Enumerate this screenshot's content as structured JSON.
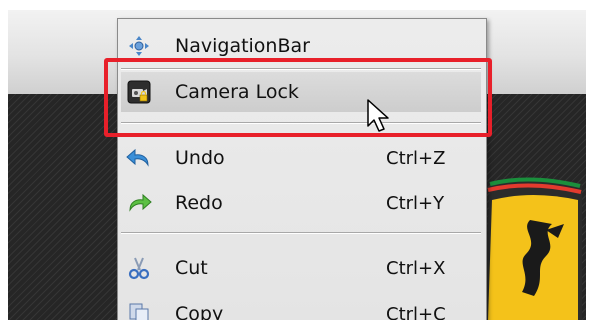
{
  "menu": {
    "items": [
      {
        "label": "NavigationBar",
        "shortcut": "",
        "icon": "navigation-arrows-icon"
      },
      {
        "label": "Camera Lock",
        "shortcut": "",
        "icon": "camera-lock-icon"
      },
      {
        "label": "Undo",
        "shortcut": "Ctrl+Z",
        "icon": "undo-arrow-icon"
      },
      {
        "label": "Redo",
        "shortcut": "Ctrl+Y",
        "icon": "redo-arrow-icon"
      },
      {
        "label": "Cut",
        "shortcut": "Ctrl+X",
        "icon": "scissors-icon"
      },
      {
        "label": "Copy",
        "shortcut": "Ctrl+C",
        "icon": "copy-icon"
      }
    ]
  },
  "colors": {
    "highlight": "#e8202a",
    "logo_yellow": "#f4c21a"
  }
}
